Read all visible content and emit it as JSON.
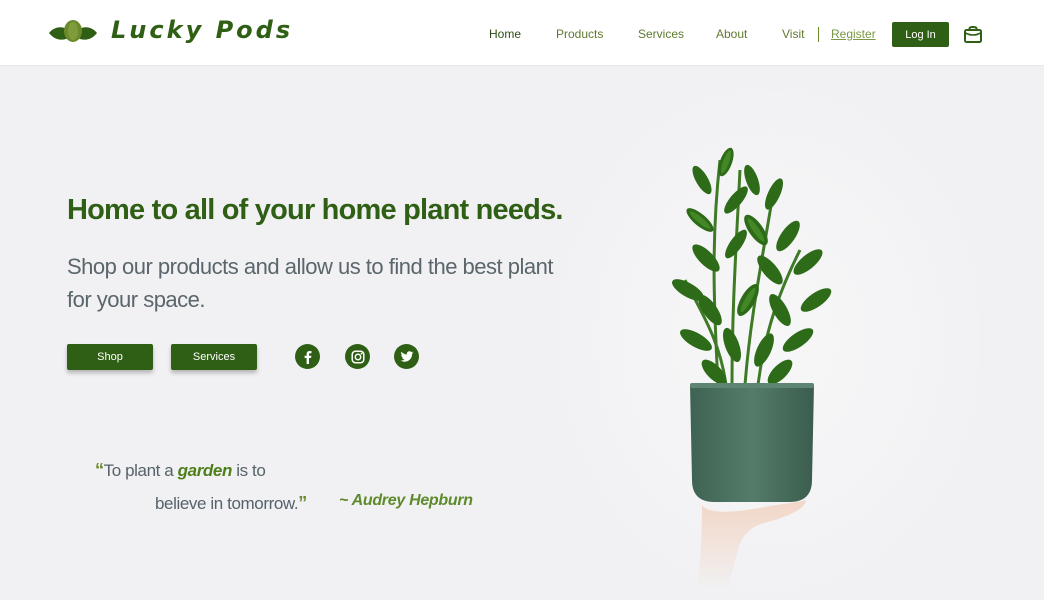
{
  "brand": {
    "name": "Lucky Pods"
  },
  "nav": {
    "items": [
      {
        "label": "Home",
        "active": true
      },
      {
        "label": "Products",
        "active": false
      },
      {
        "label": "Services",
        "active": false
      },
      {
        "label": "About",
        "active": false
      },
      {
        "label": "Visit",
        "active": false
      }
    ],
    "register": "Register",
    "login": "Log In",
    "cart_icon": "shopping-bag-icon"
  },
  "hero": {
    "headline": "Home to all of your home plant needs.",
    "subhead": "Shop our products and allow us to find the best plant for your space.",
    "buttons": {
      "shop": "Shop",
      "services": "Services"
    },
    "social": [
      "facebook-icon",
      "instagram-icon",
      "twitter-icon"
    ]
  },
  "quote": {
    "open": "“",
    "part1": "To plant a ",
    "highlight": "garden",
    "part2": " is to",
    "line2": "believe in tomorrow.",
    "close": "”",
    "author": "~ Audrey Hepburn"
  },
  "colors": {
    "brand_green": "#2f5f14",
    "nav_text": "#5f7a2f",
    "body_text": "#5a666b",
    "background": "#f1f1f3",
    "pot": "#4d7463"
  }
}
